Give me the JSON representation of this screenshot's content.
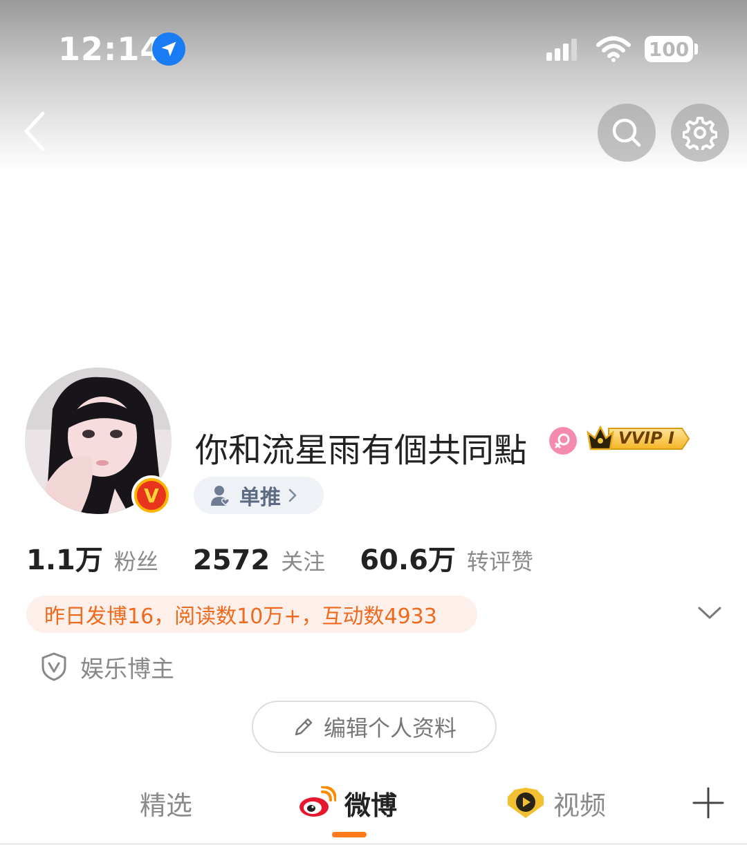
{
  "status_bar": {
    "time": "12:14",
    "battery": "100",
    "icons": [
      "location-arrow-icon",
      "cellular-signal-icon",
      "wifi-icon",
      "battery-icon"
    ]
  },
  "nav": {
    "icons": [
      "back-chevron-icon",
      "search-icon",
      "gear-icon"
    ]
  },
  "profile": {
    "username": "你和流星雨有個共同點",
    "verified_badge_letter": "V",
    "vvip_label": "VVIP I",
    "fan_tag_label": "单推",
    "gender": "female"
  },
  "stats": [
    {
      "value": "1.1万",
      "label": "粉丝"
    },
    {
      "value": "2572",
      "label": "关注"
    },
    {
      "value": "60.6万",
      "label": "转评赞"
    }
  ],
  "activity": {
    "text": "昨日发博16，阅读数10万+，互动数4933"
  },
  "category": {
    "label": "娱乐博主"
  },
  "edit_profile": {
    "label": "编辑个人资料"
  },
  "tabs": [
    {
      "label": "精选",
      "active": false
    },
    {
      "label": "微博",
      "active": true
    },
    {
      "label": "视频",
      "active": false
    }
  ],
  "colors": {
    "accent": "#ff7a1a",
    "activity_text": "#ef6a1e",
    "activity_bg": "#fdf0ea",
    "verified_red": "#e8341c",
    "verified_gold": "#ffb400",
    "location_blue": "#1a7cf5",
    "gender_pink": "#f58ab0"
  }
}
